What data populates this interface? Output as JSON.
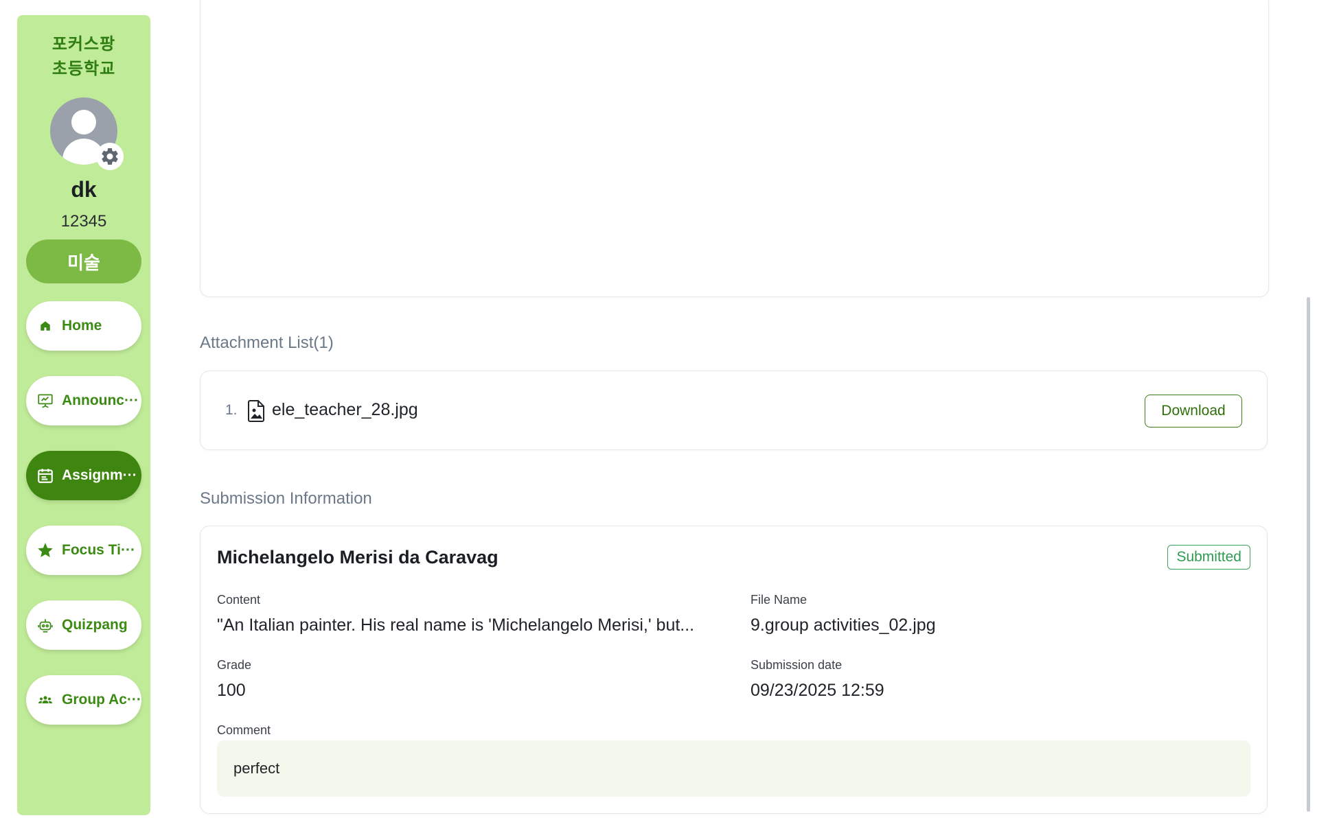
{
  "sidebar": {
    "school_line1": "포커스팡",
    "school_line2": "초등학교",
    "username": "dk",
    "user_id": "12345",
    "subject": "미술",
    "nav": {
      "home": "Home",
      "announcements": "Announc···",
      "assignments": "Assignm···",
      "focus_time": "Focus Ti···",
      "quizpang": "Quizpang",
      "group_activities": "Group Ac···"
    },
    "active_item": "assignments"
  },
  "attachments": {
    "title": "Attachment List(1)",
    "items": [
      {
        "number": "1.",
        "file_name": "ele_teacher_28.jpg",
        "action_label": "Download"
      }
    ]
  },
  "submission": {
    "title": "Submission Information",
    "student_name": "Michelangelo Merisi da Caravag",
    "status": "Submitted",
    "content_label": "Content",
    "content_value": "\"An Italian painter. His real name is 'Michelangelo Merisi,' but...",
    "file_name_label": "File Name",
    "file_name_value": "9.group activities_02.jpg",
    "grade_label": "Grade",
    "grade_value": "100",
    "date_label": "Submission date",
    "date_value": "09/23/2025 12:59",
    "comment_label": "Comment",
    "comment_value": "perfect"
  },
  "colors": {
    "sidebar_bg": "#c0eb98",
    "brand_green": "#3e860f",
    "subject_green": "#7cba45",
    "status_green": "#2e9a52"
  }
}
